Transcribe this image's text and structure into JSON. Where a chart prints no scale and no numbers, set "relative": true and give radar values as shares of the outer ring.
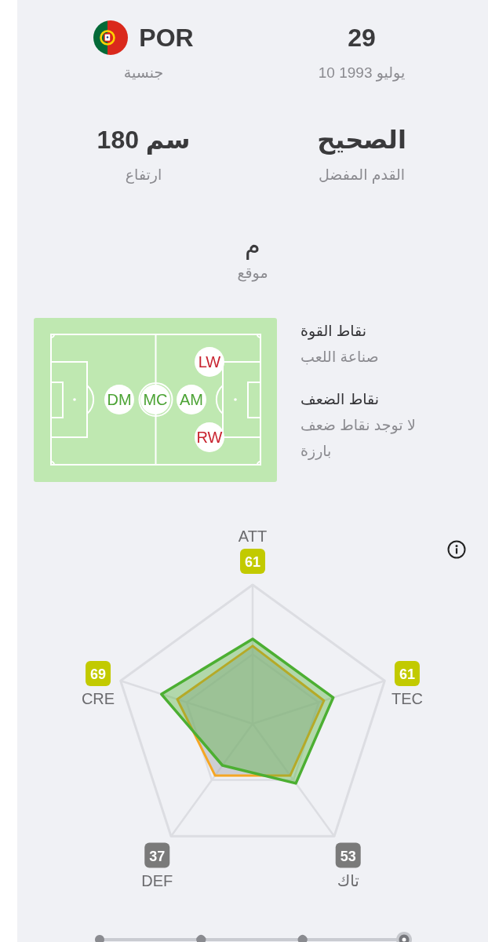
{
  "details": [
    {
      "kind": "plain",
      "value": "29",
      "label": "10 يوليو 1993"
    },
    {
      "kind": "flag",
      "value": "POR",
      "label": "جنسية"
    },
    {
      "kind": "plain",
      "value": "الصحيح",
      "label": "القدم المفضل"
    },
    {
      "kind": "plain",
      "value": "180 سم",
      "label": "ارتفاع"
    }
  ],
  "position": {
    "value": "م",
    "label": "موقع"
  },
  "pitch": {
    "positions": [
      {
        "label": "LW",
        "kind": "left-wing",
        "color": "#c8232f"
      },
      {
        "label": "AM",
        "kind": "attacking-midfield",
        "color": "#4ca335"
      },
      {
        "label": "MC",
        "kind": "central-midfield",
        "color": "#4ca335"
      },
      {
        "label": "DM",
        "kind": "defensive-midfield",
        "color": "#4ca335"
      },
      {
        "label": "RW",
        "kind": "right-wing",
        "color": "#c8232f"
      }
    ]
  },
  "notes": [
    {
      "title": "نقاط القوة",
      "items": [
        "صناعة اللعب"
      ]
    },
    {
      "title": "نقاط الضعف",
      "items": [
        "لا توجد نقاط ضعف بارزة"
      ]
    }
  ],
  "ratings": {
    "chart_data": {
      "type": "radar",
      "categories": [
        "ATT",
        "TEC",
        "تاك",
        "DEF",
        "CRE"
      ],
      "series": [
        {
          "color": "#4caf32",
          "values": [
            0.61,
            0.61,
            0.53,
            0.37,
            0.69
          ]
        }
      ],
      "relative": true,
      "value_labels": [
        "61",
        "61",
        "53",
        "37",
        "69"
      ]
    },
    "badges": [
      {
        "color": "#c2ca00"
      },
      {
        "color": "#c2ca00"
      },
      {
        "color": "#7a7a7a"
      },
      {
        "color": "#7a7a7a"
      },
      {
        "color": "#c2ca00"
      }
    ]
  },
  "timeline": {
    "stops": [
      {
        "selected": false
      },
      {
        "selected": false
      },
      {
        "selected": false
      },
      {
        "selected": true
      }
    ]
  }
}
